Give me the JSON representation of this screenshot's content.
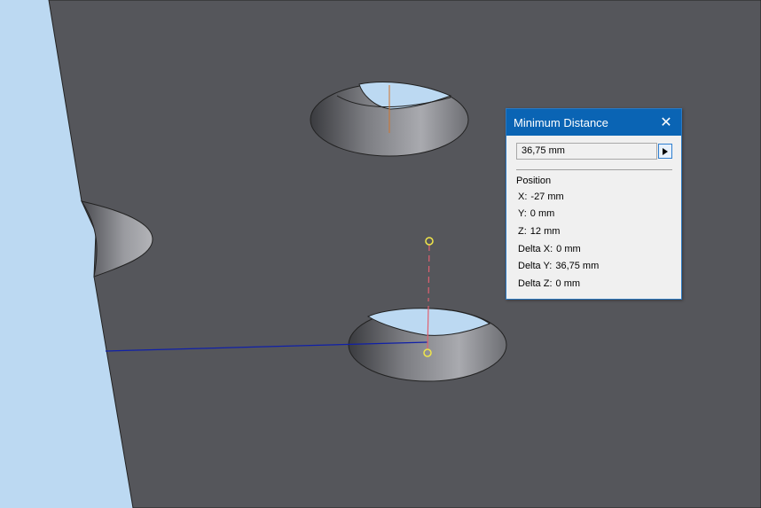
{
  "dialog": {
    "title": "Minimum Distance",
    "close_glyph": "✕",
    "distance_value": "36,75 mm",
    "position_heading": "Position",
    "position_rows": [
      {
        "label": "X:",
        "value": "-27 mm"
      },
      {
        "label": "Y:",
        "value": "0 mm"
      },
      {
        "label": "Z:",
        "value": "12 mm"
      },
      {
        "label": "Delta X:",
        "value": "0 mm"
      },
      {
        "label": "Delta Y:",
        "value": "36,75 mm"
      },
      {
        "label": "Delta Z:",
        "value": "0 mm"
      }
    ]
  },
  "colors": {
    "background": "#bcd9f2",
    "part_face": "#55565b",
    "titlebar": "#0a64b4",
    "measure_point": "#f0e64a",
    "measure_line": "#e06070",
    "axis_line": "#1020a8",
    "axis_tick": "#d0742c"
  },
  "icons": {
    "close": "close-icon",
    "expand": "play-triangle-icon"
  }
}
